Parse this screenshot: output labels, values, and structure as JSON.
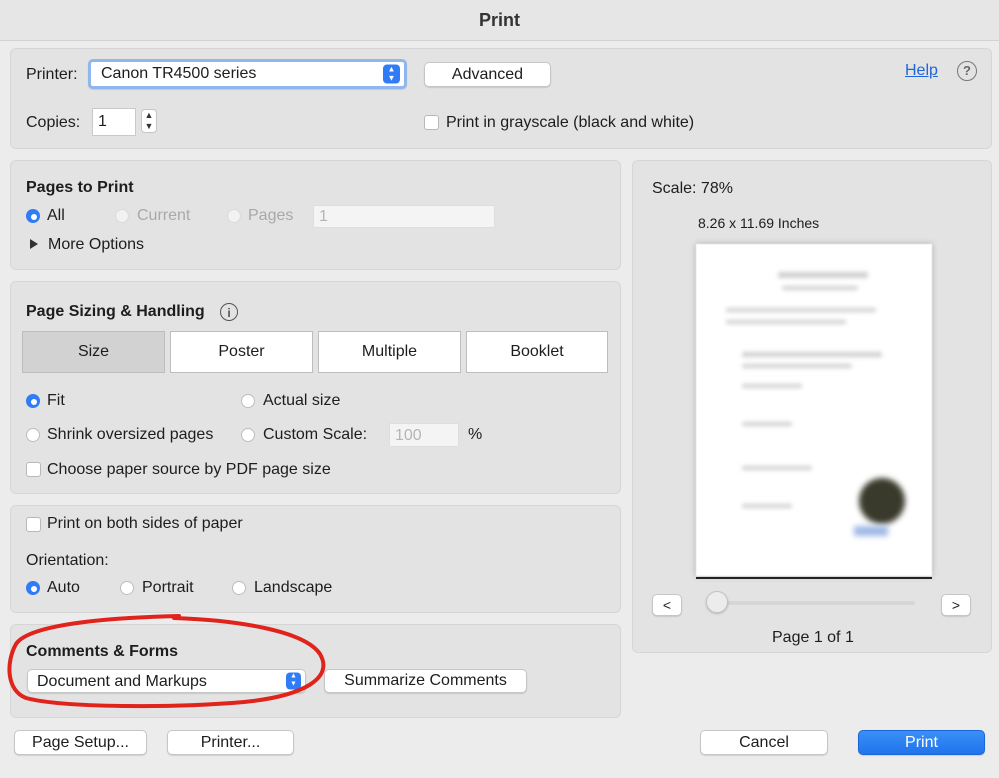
{
  "window": {
    "title": "Print"
  },
  "printer": {
    "label": "Printer:",
    "selected": "Canon TR4500 series",
    "advanced_button": "Advanced",
    "help_link": "Help",
    "help_icon": "?"
  },
  "copies": {
    "label": "Copies:",
    "value": "1",
    "grayscale_label": "Print in grayscale (black and white)"
  },
  "pages": {
    "title": "Pages to Print",
    "all": "All",
    "current": "Current",
    "pages": "Pages",
    "range_value": "1",
    "more_options": "More Options"
  },
  "sizing": {
    "title": "Page Sizing & Handling",
    "info_icon": "i",
    "tabs": [
      "Size",
      "Poster",
      "Multiple",
      "Booklet"
    ],
    "fit": "Fit",
    "actual_size": "Actual size",
    "shrink": "Shrink oversized pages",
    "custom_scale": "Custom Scale:",
    "custom_value": "100",
    "percent": "%",
    "paper_source": "Choose paper source by PDF page size"
  },
  "duplex": {
    "both_sides": "Print on both sides of paper",
    "orientation_label": "Orientation:",
    "auto": "Auto",
    "portrait": "Portrait",
    "landscape": "Landscape"
  },
  "comments": {
    "title": "Comments & Forms",
    "selected": "Document and Markups",
    "summarize": "Summarize Comments"
  },
  "preview": {
    "scale": "Scale:  78%",
    "paper_size": "8.26 x 11.69 Inches",
    "prev": "<",
    "next": ">",
    "page_indicator": "Page 1 of 1"
  },
  "footer": {
    "page_setup": "Page Setup...",
    "printer": "Printer...",
    "cancel": "Cancel",
    "print": "Print"
  },
  "colors": {
    "accent": "#2f7cf6",
    "annotation": "#e0231b"
  }
}
